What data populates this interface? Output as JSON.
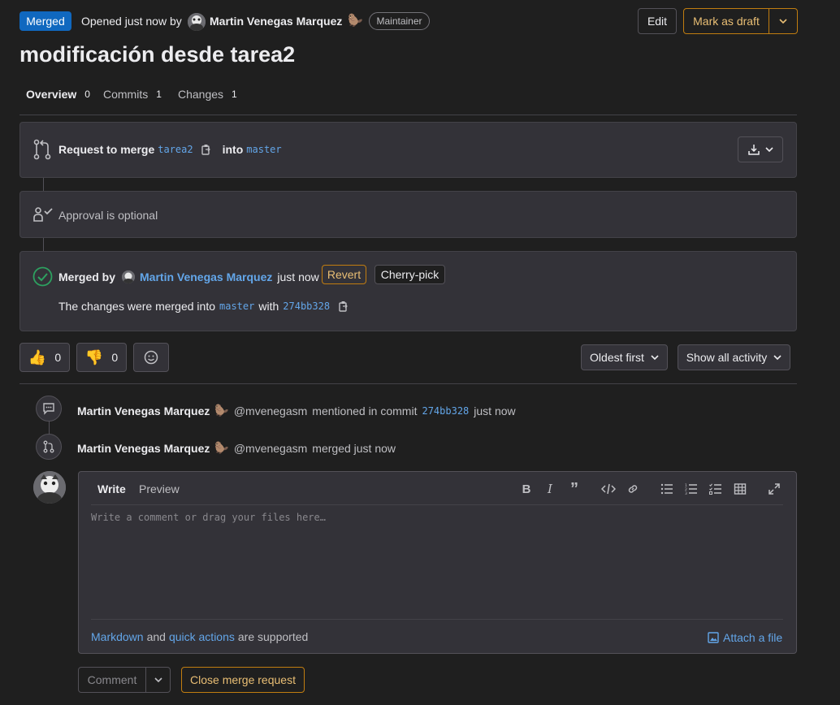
{
  "header": {
    "status_badge": "Merged",
    "opened_text": "Opened just now by",
    "author_name": "Martin Venegas Marquez",
    "role_badge": "Maintainer",
    "edit_label": "Edit",
    "mark_draft_label": "Mark as draft",
    "title": "modificación desde tarea2"
  },
  "tabs": [
    {
      "label": "Overview",
      "count": "0"
    },
    {
      "label": "Commits",
      "count": "1"
    },
    {
      "label": "Changes",
      "count": "1"
    }
  ],
  "merge_request": {
    "prefix": "Request to merge",
    "source_branch": "tarea2",
    "into": "into",
    "target_branch": "master"
  },
  "approval": {
    "text": "Approval is optional"
  },
  "merged": {
    "merged_by": "Merged by",
    "user": "Martin Venegas Marquez",
    "time": "just now",
    "revert_label": "Revert",
    "cherry_pick_label": "Cherry-pick",
    "changes_prefix": "The changes were merged into",
    "branch": "master",
    "with": "with",
    "commit": "274bb328"
  },
  "reactions": {
    "thumbs_up_count": "0",
    "thumbs_down_count": "0"
  },
  "sort": {
    "order_label": "Oldest first",
    "filter_label": "Show all activity"
  },
  "activity": [
    {
      "user": "Martin Venegas Marquez",
      "handle": "@mvenegasm",
      "action": "mentioned in commit",
      "commit": "274bb328",
      "time": "just now"
    },
    {
      "user": "Martin Venegas Marquez",
      "handle": "@mvenegasm",
      "action": "merged just now"
    }
  ],
  "editor": {
    "write_tab": "Write",
    "preview_tab": "Preview",
    "placeholder": "Write a comment or drag your files here…",
    "markdown_link": "Markdown",
    "and_text": "and",
    "quick_actions_link": "quick actions",
    "supported_text": "are supported",
    "attach_label": "Attach a file"
  },
  "footer": {
    "comment_label": "Comment",
    "close_label": "Close merge request"
  },
  "colors": {
    "background": "#1f1f1f",
    "panel": "#333238",
    "link": "#63a6e9",
    "warning": "#c17d10",
    "merged_badge": "#1068bf",
    "success": "#2da160"
  }
}
